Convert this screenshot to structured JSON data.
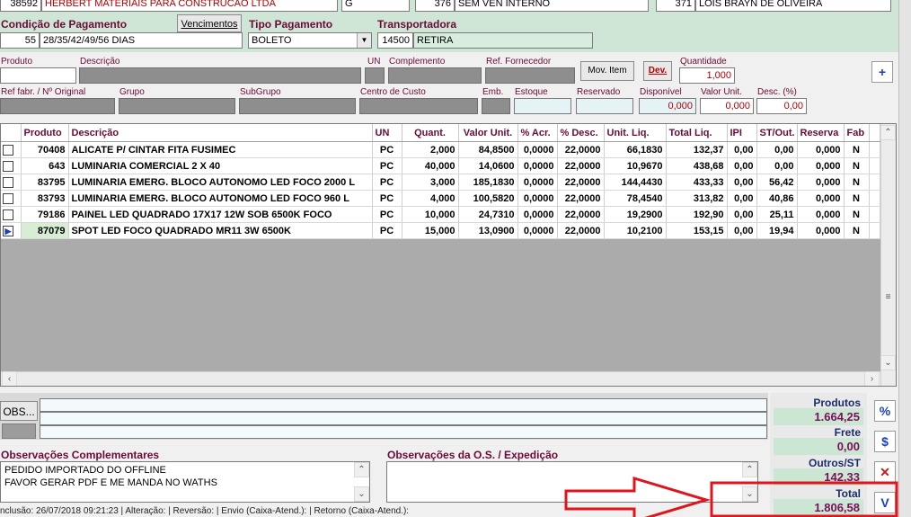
{
  "header": {
    "supplier_code": "38592",
    "supplier_name": "HERBERT MATERIAIS PARA CONSTRUCAO LTDA",
    "field_g": "G",
    "seller_code": "376",
    "seller_name": "SEM VEN INTERNO",
    "user_code": "371",
    "user_name": "LOIS BRAYN DE OLIVEIRA"
  },
  "payment": {
    "cond_label": "Condição de Pagamento",
    "cond_code": "55",
    "cond_value": "28/35/42/49/56 DIAS",
    "vencimentos_label": "Vencimentos",
    "tipo_label": "Tipo Pagamento",
    "tipo_value": "BOLETO",
    "transp_label": "Transportadora",
    "transp_code": "14500",
    "transp_value": "RETIRA"
  },
  "item_entry": {
    "produto": "Produto",
    "descricao": "Descrição",
    "un": "UN",
    "complemento": "Complemento",
    "ref_fornecedor": "Ref. Fornecedor",
    "mov_item": "Mov. Item",
    "dev": "Dev.",
    "quantidade": "Quantidade",
    "quantidade_value": "1,000",
    "add": "+",
    "ref_fabr": "Ref fabr. / Nº Original",
    "grupo": "Grupo",
    "subgrupo": "SubGrupo",
    "centro_custo": "Centro de Custo",
    "emb": "Emb.",
    "estoque": "Estoque",
    "reservado": "Reservado",
    "disponivel": "Disponível",
    "disponivel_value": "0,000",
    "valor_unit": "Valor Unit.",
    "valor_unit_value": "0,000",
    "desc_pct": "Desc. (%)",
    "desc_pct_value": "0,00"
  },
  "grid": {
    "columns": [
      "Produto",
      "Descrição",
      "UN",
      "Quant.",
      "Valor Unit.",
      "% Acr.",
      "% Desc.",
      "Unit. Liq.",
      "Total Liq.",
      "IPI",
      "ST/Out.",
      "Reserva",
      "Fab"
    ],
    "rows": [
      [
        "70408",
        "ALICATE P/ CINTAR FITA FUSIMEC",
        "PC",
        "2,000",
        "84,8500",
        "0,0000",
        "22,0000",
        "66,1830",
        "132,37",
        "0,00",
        "0,00",
        "0,000",
        "N"
      ],
      [
        "643",
        "LUMINARIA COMERCIAL  2 X  40",
        "PC",
        "40,000",
        "14,0600",
        "0,0000",
        "22,0000",
        "10,9670",
        "438,68",
        "0,00",
        "0,00",
        "0,000",
        "N"
      ],
      [
        "83795",
        "LUMINARIA EMERG. BLOCO AUTONOMO LED FOCO 2000 L",
        "PC",
        "3,000",
        "185,1830",
        "0,0000",
        "22,0000",
        "144,4430",
        "433,33",
        "0,00",
        "56,42",
        "0,000",
        "N"
      ],
      [
        "83793",
        "LUMINARIA EMERG. BLOCO AUTONOMO LED FOCO 960 L",
        "PC",
        "4,000",
        "100,5820",
        "0,0000",
        "22,0000",
        "78,4540",
        "313,82",
        "0,00",
        "40,86",
        "0,000",
        "N"
      ],
      [
        "79186",
        "PAINEL LED QUADRADO 17X17 12W SOB 6500K FOCO",
        "PC",
        "10,000",
        "24,7310",
        "0,0000",
        "22,0000",
        "19,2900",
        "192,90",
        "0,00",
        "25,11",
        "0,000",
        "N"
      ],
      [
        "87079",
        "SPOT LED FOCO QUADRADO MR11 3W 6500K",
        "PC",
        "15,000",
        "13,0900",
        "0,0000",
        "22,0000",
        "10,2100",
        "153,15",
        "0,00",
        "19,94",
        "0,000",
        "N"
      ]
    ]
  },
  "bottom": {
    "obs_button": "OBS...",
    "obs_comp_label": "Observações Complementares",
    "obs_comp_lines": [
      "PEDIDO IMPORTADO DO OFFLINE",
      "FAVOR GERAR PDF E ME MANDA NO WATHS"
    ],
    "obs_os_label": "Observações da O.S. / Expedição",
    "status_bar": "nclusão:  26/07/2018 09:21:23 | Alteração:  | Reversão:  | Envio (Caixa-Atend.):  | Retorno (Caixa-Atend.):"
  },
  "totals": {
    "produtos_label": "Produtos",
    "produtos_value": "1.664,25",
    "frete_label": "Frete",
    "frete_value": "0,00",
    "outros_label": "Outros/ST",
    "outros_value": "142,33",
    "total_label": "Total",
    "total_value": "1.806,58"
  },
  "side_buttons": {
    "percent": "%",
    "dollar": "$",
    "close": "✕",
    "confirm": "V"
  },
  "colors": {
    "label": "#6b0a38",
    "annotation_red": "#e0141c",
    "total_value": "#7a0e5c"
  }
}
